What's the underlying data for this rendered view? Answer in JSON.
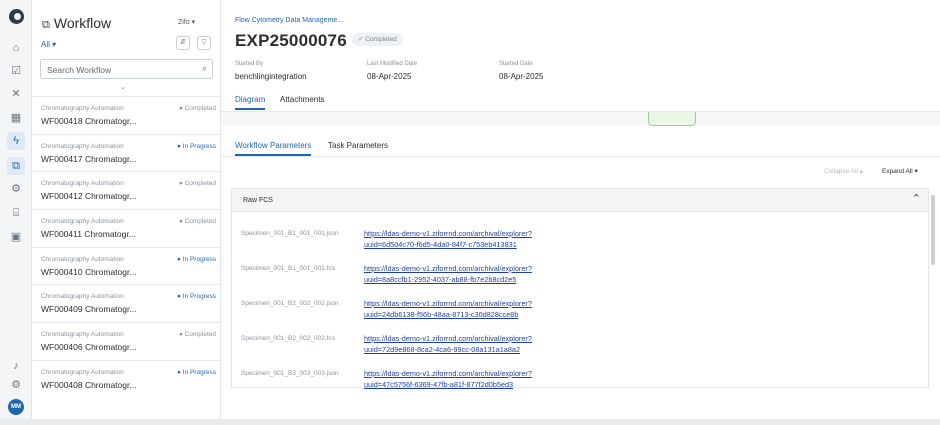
{
  "sidebar_rail": {
    "icons": [
      {
        "name": "home-icon",
        "glyph": "⌂"
      },
      {
        "name": "tasks-icon",
        "glyph": "☑"
      },
      {
        "name": "tools-icon",
        "glyph": "✕"
      },
      {
        "name": "grid-icon",
        "glyph": "▦"
      },
      {
        "name": "pipeline-icon",
        "glyph": "ϟ"
      },
      {
        "name": "workflow-icon",
        "glyph": "⧉"
      },
      {
        "name": "settings-icon",
        "glyph": "⚙"
      },
      {
        "name": "archive-icon",
        "glyph": "⌸"
      },
      {
        "name": "storage-icon",
        "glyph": "▣"
      }
    ],
    "bottom_icons": [
      {
        "name": "bell-icon",
        "glyph": "♪"
      },
      {
        "name": "gear-icon",
        "glyph": "⚙"
      }
    ],
    "avatar_initials": "MM"
  },
  "list_panel": {
    "title": "Workflow",
    "org": "Zifo ▾",
    "filter": "All ▾",
    "search_placeholder": "Search Workflow",
    "items": [
      {
        "category": "Chromatography Automation",
        "status": "Completed",
        "status_type": "completed",
        "name": "WF000418 Chromatogr..."
      },
      {
        "category": "Chromatography Automation",
        "status": "In Progress",
        "status_type": "inprogress",
        "name": "WF000417 Chromatogr..."
      },
      {
        "category": "Chromatography Automation",
        "status": "Completed",
        "status_type": "completed",
        "name": "WF000412 Chromatogr..."
      },
      {
        "category": "Chromatography Automation",
        "status": "Completed",
        "status_type": "completed",
        "name": "WF000411 Chromatogr..."
      },
      {
        "category": "Chromatography Automation",
        "status": "In Progress",
        "status_type": "inprogress",
        "name": "WF000410 Chromatogr..."
      },
      {
        "category": "Chromatography Automation",
        "status": "In Progress",
        "status_type": "inprogress",
        "name": "WF000409 Chromatogr..."
      },
      {
        "category": "Chromatography Automation",
        "status": "Completed",
        "status_type": "completed",
        "name": "WF000406 Chromatogr..."
      },
      {
        "category": "Chromatography Automation",
        "status": "In Progress",
        "status_type": "inprogress",
        "name": "WF000408 Chromatogr..."
      }
    ]
  },
  "main": {
    "breadcrumb": "Flow Cytometry Data Manageme...",
    "title": "EXP25000076",
    "status": "✓ Completed",
    "meta": [
      {
        "label": "Started By",
        "value": "benchlingintegration"
      },
      {
        "label": "Last Modified Date",
        "value": "08-Apr-2025"
      },
      {
        "label": "Started Date",
        "value": "08-Apr-2025"
      }
    ],
    "tabs": [
      "Diagram",
      "Attachments"
    ],
    "subtabs": [
      "Workflow Parameters",
      "Task Parameters"
    ],
    "collapse_all": "Collapse All ▴",
    "expand_all": "Expand All ▾",
    "section_title": "Raw FCS",
    "files": [
      {
        "name": "Specimen_001_B1_001_001.json",
        "link_line1": "https://ldas-demo-v1.ziforrnd.com/archival/explorer?",
        "link_line2": "uuid=6d504c70-f6d5-4da0-84f7-c753eb413831"
      },
      {
        "name": "Specimen_001_B1_001_001.fcs",
        "link_line1": "https://ldas-demo-v1.ziforrnd.com/archival/explorer?",
        "link_line2": "uuid=8a8ccfb1-2952-4037-ab88-fb7e2b8cd2e5"
      },
      {
        "name": "Specimen_001_B2_002_002.json",
        "link_line1": "https://ldas-demo-v1.ziforrnd.com/archival/explorer?",
        "link_line2": "uuid=24db6138-f56b-48aa-8713-c30d828cce8b"
      },
      {
        "name": "Specimen_001_B2_002_002.fcs",
        "link_line1": "https://ldas-demo-v1.ziforrnd.com/archival/explorer?",
        "link_line2": "uuid=72d9e868-8ca2-4ca6-99cc-08a131a1a8a2"
      },
      {
        "name": "Specimen_001_B3_003_003.json",
        "link_line1": "https://ldas-demo-v1.ziforrnd.com/archival/explorer?",
        "link_line2": "uuid=47c5756f-6369-47fb-a81f-877f2d0b5ed3"
      }
    ]
  }
}
